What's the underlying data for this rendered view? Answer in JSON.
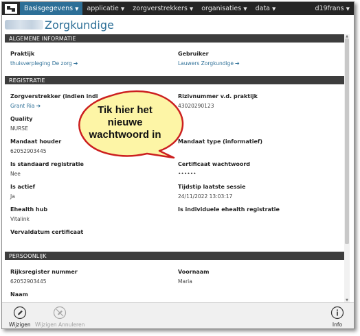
{
  "navbar": {
    "items": [
      {
        "label": "Basisgegevens",
        "active": true
      },
      {
        "label": "applicatie"
      },
      {
        "label": "zorgverstrekkers"
      },
      {
        "label": "organisaties"
      },
      {
        "label": "data"
      }
    ],
    "user": "d19frans"
  },
  "page": {
    "title": "Zorgkundige"
  },
  "sections": {
    "algemeen": {
      "title": "ALGEMENE INFORMATIE",
      "praktijk_label": "Praktijk",
      "praktijk_value": "thuisverpleging De zorg",
      "gebruiker_label": "Gebruiker",
      "gebruiker_value": "Lauwers Zorgkundige"
    },
    "registratie": {
      "title": "REGISTRATIE",
      "zorgverstrekker_label": "Zorgverstrekker (indien individuele regi",
      "zorgverstrekker_value": "Grant Ria",
      "riziv_label": "Rizivnummer v.d. praktijk",
      "riziv_value": "43020290123",
      "quality_label": "Quality",
      "quality_value": "NURSE",
      "mandaat_houder_label": "Mandaat houder",
      "mandaat_houder_value": "62052903445",
      "mandaat_type_label": "Mandaat type (informatief)",
      "standaard_label": "Is standaard registratie",
      "standaard_value": "Nee",
      "certificaat_label": "Certificaat wachtwoord",
      "certificaat_value": "••••••",
      "actief_label": "Is actief",
      "actief_value": "Ja",
      "sessie_label": "Tijdstip laatste sessie",
      "sessie_value": "24/11/2022 13:03:17",
      "ehealth_hub_label": "Ehealth hub",
      "ehealth_hub_value": "Vitalink",
      "individuele_label": "Is individuele ehealth registratie",
      "vervaldatum_label": "Vervaldatum certificaat"
    },
    "persoonlijk": {
      "title": "PERSOONLIJK",
      "rijksregister_label": "Rijksregister nummer",
      "rijksregister_value": "62052903445",
      "voornaam_label": "Voornaam",
      "voornaam_value": "Maria",
      "naam_label": "Naam"
    }
  },
  "toolbar": {
    "wijzigen": "Wijzigen",
    "annuleren": "Wijzigen Annuleren",
    "info": "Info"
  },
  "callout": {
    "lines": [
      "Tik hier het",
      "nieuwe",
      "wachtwoord in"
    ],
    "fill": "#fdf5a6",
    "stroke": "#cc1f1f"
  },
  "colors": {
    "accent": "#2d6f97",
    "navbar": "#252525",
    "section": "#3d3d3d"
  }
}
